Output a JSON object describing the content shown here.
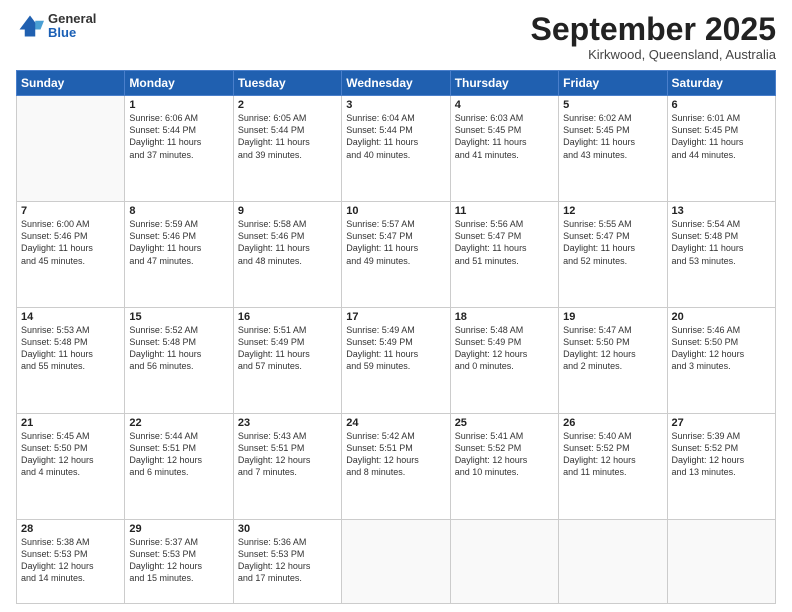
{
  "header": {
    "logo_general": "General",
    "logo_blue": "Blue",
    "month": "September 2025",
    "location": "Kirkwood, Queensland, Australia"
  },
  "days_of_week": [
    "Sunday",
    "Monday",
    "Tuesday",
    "Wednesday",
    "Thursday",
    "Friday",
    "Saturday"
  ],
  "weeks": [
    [
      {
        "day": "",
        "info": ""
      },
      {
        "day": "1",
        "info": "Sunrise: 6:06 AM\nSunset: 5:44 PM\nDaylight: 11 hours\nand 37 minutes."
      },
      {
        "day": "2",
        "info": "Sunrise: 6:05 AM\nSunset: 5:44 PM\nDaylight: 11 hours\nand 39 minutes."
      },
      {
        "day": "3",
        "info": "Sunrise: 6:04 AM\nSunset: 5:44 PM\nDaylight: 11 hours\nand 40 minutes."
      },
      {
        "day": "4",
        "info": "Sunrise: 6:03 AM\nSunset: 5:45 PM\nDaylight: 11 hours\nand 41 minutes."
      },
      {
        "day": "5",
        "info": "Sunrise: 6:02 AM\nSunset: 5:45 PM\nDaylight: 11 hours\nand 43 minutes."
      },
      {
        "day": "6",
        "info": "Sunrise: 6:01 AM\nSunset: 5:45 PM\nDaylight: 11 hours\nand 44 minutes."
      }
    ],
    [
      {
        "day": "7",
        "info": "Sunrise: 6:00 AM\nSunset: 5:46 PM\nDaylight: 11 hours\nand 45 minutes."
      },
      {
        "day": "8",
        "info": "Sunrise: 5:59 AM\nSunset: 5:46 PM\nDaylight: 11 hours\nand 47 minutes."
      },
      {
        "day": "9",
        "info": "Sunrise: 5:58 AM\nSunset: 5:46 PM\nDaylight: 11 hours\nand 48 minutes."
      },
      {
        "day": "10",
        "info": "Sunrise: 5:57 AM\nSunset: 5:47 PM\nDaylight: 11 hours\nand 49 minutes."
      },
      {
        "day": "11",
        "info": "Sunrise: 5:56 AM\nSunset: 5:47 PM\nDaylight: 11 hours\nand 51 minutes."
      },
      {
        "day": "12",
        "info": "Sunrise: 5:55 AM\nSunset: 5:47 PM\nDaylight: 11 hours\nand 52 minutes."
      },
      {
        "day": "13",
        "info": "Sunrise: 5:54 AM\nSunset: 5:48 PM\nDaylight: 11 hours\nand 53 minutes."
      }
    ],
    [
      {
        "day": "14",
        "info": "Sunrise: 5:53 AM\nSunset: 5:48 PM\nDaylight: 11 hours\nand 55 minutes."
      },
      {
        "day": "15",
        "info": "Sunrise: 5:52 AM\nSunset: 5:48 PM\nDaylight: 11 hours\nand 56 minutes."
      },
      {
        "day": "16",
        "info": "Sunrise: 5:51 AM\nSunset: 5:49 PM\nDaylight: 11 hours\nand 57 minutes."
      },
      {
        "day": "17",
        "info": "Sunrise: 5:49 AM\nSunset: 5:49 PM\nDaylight: 11 hours\nand 59 minutes."
      },
      {
        "day": "18",
        "info": "Sunrise: 5:48 AM\nSunset: 5:49 PM\nDaylight: 12 hours\nand 0 minutes."
      },
      {
        "day": "19",
        "info": "Sunrise: 5:47 AM\nSunset: 5:50 PM\nDaylight: 12 hours\nand 2 minutes."
      },
      {
        "day": "20",
        "info": "Sunrise: 5:46 AM\nSunset: 5:50 PM\nDaylight: 12 hours\nand 3 minutes."
      }
    ],
    [
      {
        "day": "21",
        "info": "Sunrise: 5:45 AM\nSunset: 5:50 PM\nDaylight: 12 hours\nand 4 minutes."
      },
      {
        "day": "22",
        "info": "Sunrise: 5:44 AM\nSunset: 5:51 PM\nDaylight: 12 hours\nand 6 minutes."
      },
      {
        "day": "23",
        "info": "Sunrise: 5:43 AM\nSunset: 5:51 PM\nDaylight: 12 hours\nand 7 minutes."
      },
      {
        "day": "24",
        "info": "Sunrise: 5:42 AM\nSunset: 5:51 PM\nDaylight: 12 hours\nand 8 minutes."
      },
      {
        "day": "25",
        "info": "Sunrise: 5:41 AM\nSunset: 5:52 PM\nDaylight: 12 hours\nand 10 minutes."
      },
      {
        "day": "26",
        "info": "Sunrise: 5:40 AM\nSunset: 5:52 PM\nDaylight: 12 hours\nand 11 minutes."
      },
      {
        "day": "27",
        "info": "Sunrise: 5:39 AM\nSunset: 5:52 PM\nDaylight: 12 hours\nand 13 minutes."
      }
    ],
    [
      {
        "day": "28",
        "info": "Sunrise: 5:38 AM\nSunset: 5:53 PM\nDaylight: 12 hours\nand 14 minutes."
      },
      {
        "day": "29",
        "info": "Sunrise: 5:37 AM\nSunset: 5:53 PM\nDaylight: 12 hours\nand 15 minutes."
      },
      {
        "day": "30",
        "info": "Sunrise: 5:36 AM\nSunset: 5:53 PM\nDaylight: 12 hours\nand 17 minutes."
      },
      {
        "day": "",
        "info": ""
      },
      {
        "day": "",
        "info": ""
      },
      {
        "day": "",
        "info": ""
      },
      {
        "day": "",
        "info": ""
      }
    ]
  ]
}
